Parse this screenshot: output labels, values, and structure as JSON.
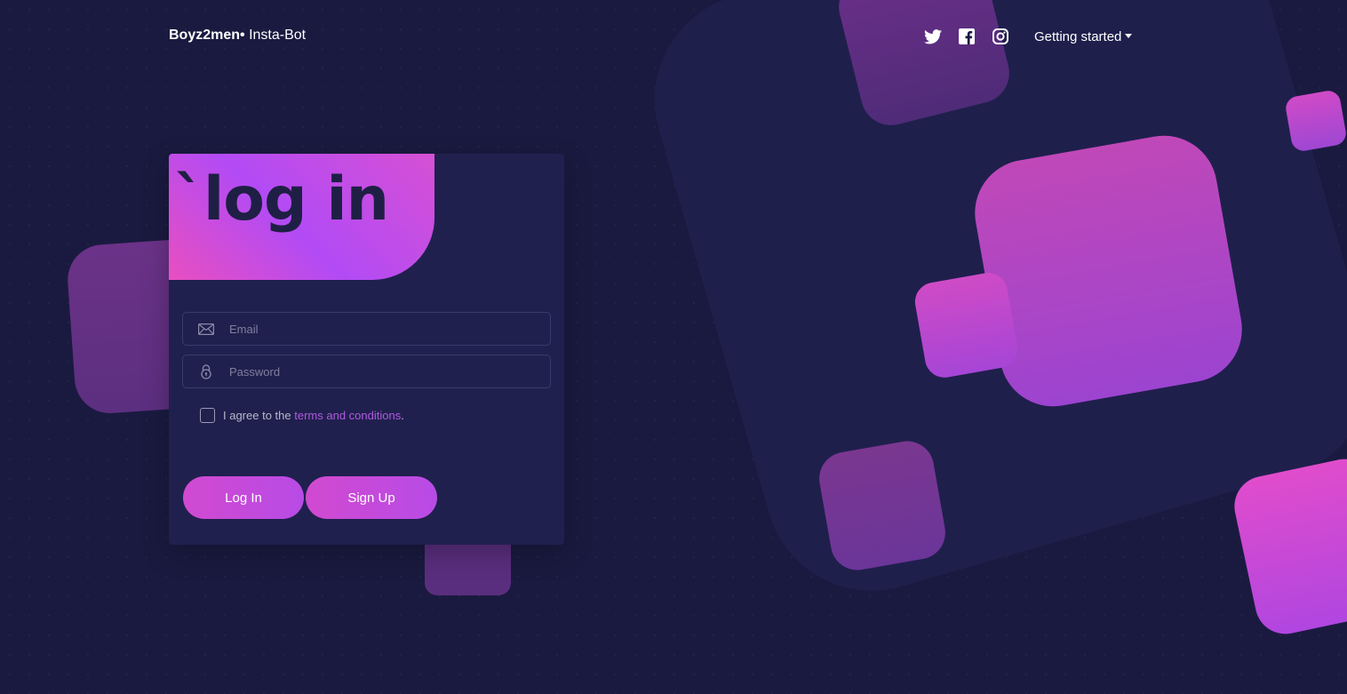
{
  "nav": {
    "brand_bold": "Boyz2men",
    "brand_dot": "•",
    "brand_rest": " Insta-Bot",
    "icons": [
      "twitter-icon",
      "facebook-icon",
      "instagram-icon"
    ],
    "getting_started": "Getting started"
  },
  "card": {
    "title": "`log in",
    "email_placeholder": "Email",
    "password_placeholder": "Password",
    "agree_prefix": "I agree to the ",
    "agree_link": "terms and conditions",
    "agree_suffix": ".",
    "login_button": "Log In",
    "signup_button": "Sign Up"
  },
  "colors": {
    "background": "#1a1a40",
    "card": "#20204e",
    "accent_pink": "#e84fc0",
    "accent_purple": "#b24bf5",
    "link": "#b05ae0"
  }
}
